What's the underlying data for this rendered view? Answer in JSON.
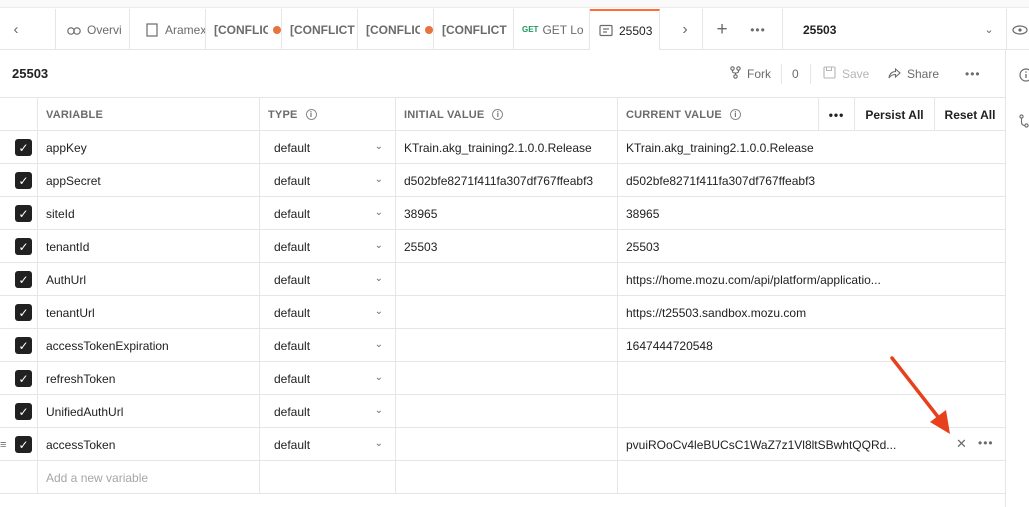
{
  "tabs": [
    {
      "label": "Overvi",
      "icon": "team-icon",
      "conflict": false,
      "dot": false
    },
    {
      "label": "Aramex",
      "icon": "document-icon",
      "conflict": false,
      "dot": false
    },
    {
      "label": "[CONFLIC",
      "icon": "",
      "conflict": true,
      "dot": true
    },
    {
      "label": "[CONFLICT",
      "icon": "",
      "conflict": true,
      "dot": false
    },
    {
      "label": "[CONFLIC",
      "icon": "",
      "conflict": true,
      "dot": true
    },
    {
      "label": "[CONFLICT",
      "icon": "",
      "conflict": true,
      "dot": false
    },
    {
      "label": "GET Lo",
      "method": "GET",
      "conflict": false,
      "dot": false
    },
    {
      "label": "25503",
      "icon": "environment-icon",
      "active": true
    }
  ],
  "env_selector": {
    "name": "25503"
  },
  "header": {
    "title": "25503",
    "fork_label": "Fork",
    "fork_count": "0",
    "save_label": "Save",
    "share_label": "Share"
  },
  "table": {
    "columns": {
      "variable": "VARIABLE",
      "type": "TYPE",
      "initial": "INITIAL VALUE",
      "current": "CURRENT VALUE"
    },
    "persist_all": "Persist All",
    "reset_all": "Reset All",
    "rows": [
      {
        "variable": "appKey",
        "type": "default",
        "initial": "KTrain.akg_training2.1.0.0.Release",
        "current": "KTrain.akg_training2.1.0.0.Release",
        "checked": true
      },
      {
        "variable": "appSecret",
        "type": "default",
        "initial": "d502bfe8271f411fa307df767ffeabf3",
        "current": "d502bfe8271f411fa307df767ffeabf3",
        "checked": true
      },
      {
        "variable": "siteId",
        "type": "default",
        "initial": "38965",
        "current": "38965",
        "checked": true
      },
      {
        "variable": "tenantId",
        "type": "default",
        "initial": "25503",
        "current": "25503",
        "checked": true
      },
      {
        "variable": "AuthUrl",
        "type": "default",
        "initial": "",
        "current": "https://home.mozu.com/api/platform/applicatio...",
        "checked": true
      },
      {
        "variable": "tenantUrl",
        "type": "default",
        "initial": "",
        "current": "https://t25503.sandbox.mozu.com",
        "checked": true
      },
      {
        "variable": "accessTokenExpiration",
        "type": "default",
        "initial": "",
        "current": "1647444720548",
        "checked": true
      },
      {
        "variable": "refreshToken",
        "type": "default",
        "initial": "",
        "current": "",
        "checked": true
      },
      {
        "variable": "UnifiedAuthUrl",
        "type": "default",
        "initial": "",
        "current": "",
        "checked": true
      },
      {
        "variable": "accessToken",
        "type": "default",
        "initial": "",
        "current": "pvuiROoCv4leBUCsC1WaZ7z1Vl8ltSBwhtQQRd...",
        "checked": true
      }
    ],
    "add_placeholder": "Add a new variable"
  },
  "colors": {
    "accent": "#ff6c37",
    "arrow": "#e8401c",
    "checkbox": "#212121"
  }
}
